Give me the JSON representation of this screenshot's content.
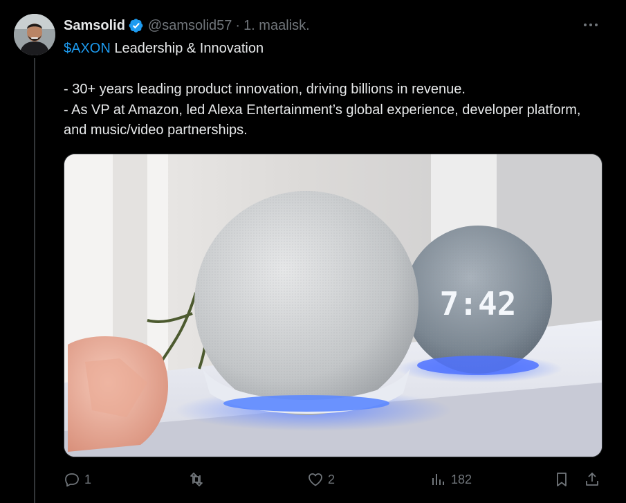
{
  "tweet": {
    "author_name": "Samsolid",
    "handle": "@samsolid57",
    "separator": "·",
    "date": "1. maalisk.",
    "verified": true,
    "cashtag": "$AXON",
    "headline_rest": " Leadership & Innovation",
    "lines": [
      "- 30+ years leading product innovation, driving billions in revenue.",
      "- As VP at Amazon, led Alexa Entertainment’s global experience, developer platform, and music/video partnerships."
    ],
    "media": {
      "clock_display": "7:42"
    }
  },
  "actions": {
    "replies": "1",
    "reposts": "",
    "likes": "2",
    "views": "182"
  },
  "colors": {
    "accent": "#1d9bf0",
    "text": "#e7e9ea",
    "muted": "#71767b",
    "background": "#000000"
  }
}
